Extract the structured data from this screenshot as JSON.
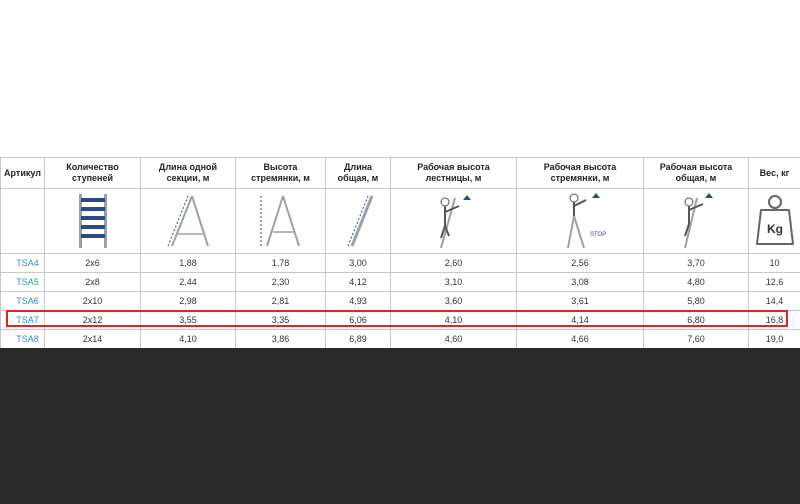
{
  "table": {
    "headers": [
      "Артикул",
      "Количество ступеней",
      "Длина одной секции, м",
      "Высота стремянки, м",
      "Длина общая, м",
      "Рабочая высота лестницы, м",
      "Рабочая высота стремянки, м",
      "Рабочая высота общая, м",
      "Вес, кг"
    ],
    "icons": {
      "ladder": "ladder-steps-icon",
      "section": "ladder-section-length-icon",
      "stepladder": "stepladder-height-icon",
      "total": "extended-ladder-length-icon",
      "work_ladder": "person-on-ladder-icon",
      "work_step": "person-on-stepladder-icon",
      "stop_label": "STOP",
      "work_total": "person-on-extended-ladder-icon",
      "weight": "weight-icon",
      "weight_label": "Kg"
    },
    "rows": [
      [
        "TSA4",
        "2x6",
        "1,88",
        "1,78",
        "3,00",
        "2,60",
        "2,56",
        "3,70",
        "10"
      ],
      [
        "TSA5",
        "2x8",
        "2,44",
        "2,30",
        "4,12",
        "3,10",
        "3,08",
        "4,80",
        "12,6"
      ],
      [
        "TSA6",
        "2x10",
        "2,98",
        "2,81",
        "4,93",
        "3,60",
        "3,61",
        "5,80",
        "14,4"
      ],
      [
        "TSA7",
        "2x12",
        "3,55",
        "3,35",
        "6,06",
        "4,10",
        "4,14",
        "6,80",
        "16,8"
      ],
      [
        "TSA8",
        "2x14",
        "4,10",
        "3,86",
        "6,89",
        "4,60",
        "4,66",
        "7,60",
        "19,0"
      ]
    ],
    "highlighted_row": "TSA7"
  },
  "colors": {
    "link": "#2a90c8",
    "highlight": "#e0242a",
    "bottom_panel": "#2b2b2b",
    "icon_blue": "#2b4a86"
  }
}
